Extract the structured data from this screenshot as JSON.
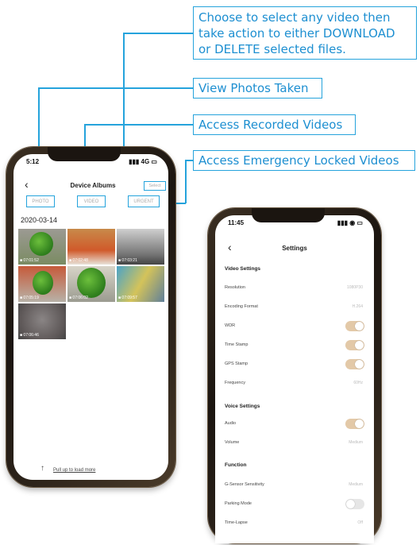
{
  "callouts": {
    "select": [
      "Choose to select any video then",
      "take action to either DOWNLOAD",
      "or DELETE selected files."
    ],
    "photos": "View Photos Taken",
    "videos": "Access Recorded Videos",
    "emergency": "Access Emergency Locked Videos"
  },
  "albums": {
    "status_time": "5:12",
    "status_right": "▮▮▮ 4G ▭",
    "title": "Device Albums",
    "select_label": "Select",
    "tabs": [
      "PHOTO",
      "VIDEO",
      "URGENT"
    ],
    "date": "2020-03-14",
    "thumbs": [
      {
        "label": "■ 07:01:52"
      },
      {
        "label": "■ 07:02:48"
      },
      {
        "label": "■ 07:03:21"
      },
      {
        "label": "■ 07:05:19"
      },
      {
        "label": "■ 07:06:02"
      },
      {
        "label": "■ 07:09:57"
      },
      {
        "label": "■ 07:06:46"
      }
    ],
    "bottom_hint": "Pull up to load more"
  },
  "settings": {
    "status_time": "11:45",
    "status_right": "▮▮▮ ◉ ▭",
    "title": "Settings",
    "sections": {
      "video": "Video Settings",
      "voice": "Voice Settings",
      "function": "Function"
    },
    "rows": {
      "resolution": {
        "label": "Resolution",
        "value": "1080P30"
      },
      "encoding": {
        "label": "Encoding Format",
        "value": "H.264"
      },
      "wdr": {
        "label": "WDR"
      },
      "timestamp": {
        "label": "Time Stamp"
      },
      "gps": {
        "label": "GPS Stamp"
      },
      "frequency": {
        "label": "Frequency",
        "value": "60Hz"
      },
      "audio": {
        "label": "Audio"
      },
      "volume": {
        "label": "Volume",
        "value": "Medium"
      },
      "gsensor": {
        "label": "G-Sensor Sensitivity",
        "value": "Medium"
      },
      "parking": {
        "label": "Parking Mode"
      },
      "timelapse": {
        "label": "Time-Lapse",
        "value": "Off"
      }
    },
    "toggles": {
      "wdr": true,
      "timestamp": true,
      "gps": true,
      "audio": true,
      "parking": false
    }
  },
  "colors": {
    "accent": "#25a3dc",
    "toggle_on": "#e3c9a8",
    "phone_frame": "#2a2118"
  }
}
